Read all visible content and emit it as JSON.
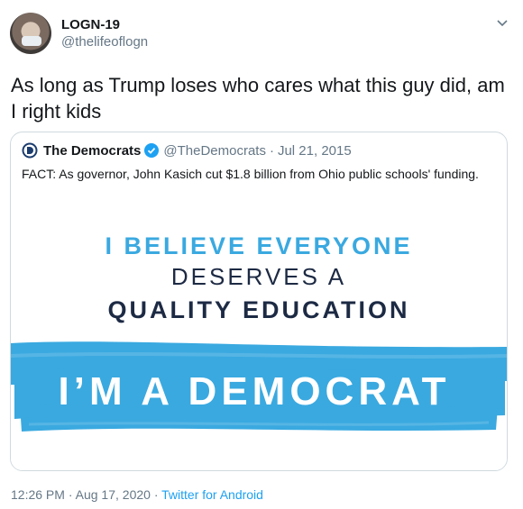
{
  "author": {
    "name": "LOGN-19",
    "handle": "@thelifeoflogn"
  },
  "tweet": {
    "text": "As long as Trump loses who cares what this guy did, am I right kids"
  },
  "quoted": {
    "name": "The Democrats",
    "handle": "@TheDemocrats",
    "separator": "·",
    "date": "Jul 21, 2015",
    "text": "FACT: As governor, John Kasich cut $1.8 billion from Ohio public schools' funding.",
    "image": {
      "line1": "I BELIEVE EVERYONE",
      "line2": "DESERVES A",
      "line3": "QUALITY EDUCATION",
      "line4": "I’M A DEMOCRAT"
    }
  },
  "footer": {
    "time": "12:26 PM",
    "separator1": "·",
    "date": "Aug 17, 2020",
    "separator2": "·",
    "source": "Twitter for Android"
  },
  "colors": {
    "accent_blue": "#1da1f2",
    "democrat_blue": "#3aa9e0",
    "navy": "#1d2a44",
    "gray": "#657786"
  }
}
